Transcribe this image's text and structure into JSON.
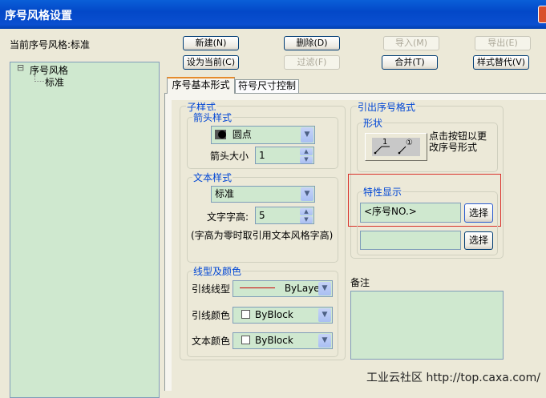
{
  "window": {
    "title": "序号风格设置"
  },
  "current_style_label": "当前序号风格:标准",
  "buttons": {
    "new": "新建(N)",
    "delete": "删除(D)",
    "import": "导入(M)",
    "export": "导出(E)",
    "set_current": "设为当前(C)",
    "filter": "过滤(F)",
    "merge": "合并(T)",
    "style_override": "样式替代(V)"
  },
  "tree": {
    "root": "序号风格",
    "child": "标准",
    "expander": "⊟"
  },
  "tabs": [
    {
      "label": "序号基本形式"
    },
    {
      "label": "符号尺寸控制"
    }
  ],
  "sub_style": {
    "title": "子样式",
    "arrow": {
      "title": "箭头样式",
      "value": "圆点",
      "size_label": "箭头大小",
      "size": "1"
    },
    "text": {
      "title": "文本样式",
      "value": "标准",
      "height_label": "文字字高:",
      "height": "5",
      "note": "(字高为零时取引用文本风格字高)"
    },
    "line": {
      "title": "线型及颜色",
      "leader_type_label": "引线线型",
      "leader_type": "ByLayer",
      "leader_color_label": "引线颜色",
      "leader_color": "ByBlock",
      "text_color_label": "文本颜色",
      "text_color": "ByBlock"
    }
  },
  "leader_format": {
    "title": "引出序号格式",
    "shape_title": "形状",
    "shape_hint": "点击按钮以更改序号形式",
    "shape_glyph1": "1",
    "shape_glyph2": "①",
    "property_title": "特性显示",
    "property_value": "<序号NO.>",
    "property_value2": "",
    "select": "选择"
  },
  "remarks": {
    "label": "备注",
    "value": ""
  },
  "watermark": "工业云社区 http://top.caxa.com/",
  "colors": {
    "field": "#cfe8cf",
    "highlight": "#d9312a",
    "leader_line": "#cc0000"
  }
}
